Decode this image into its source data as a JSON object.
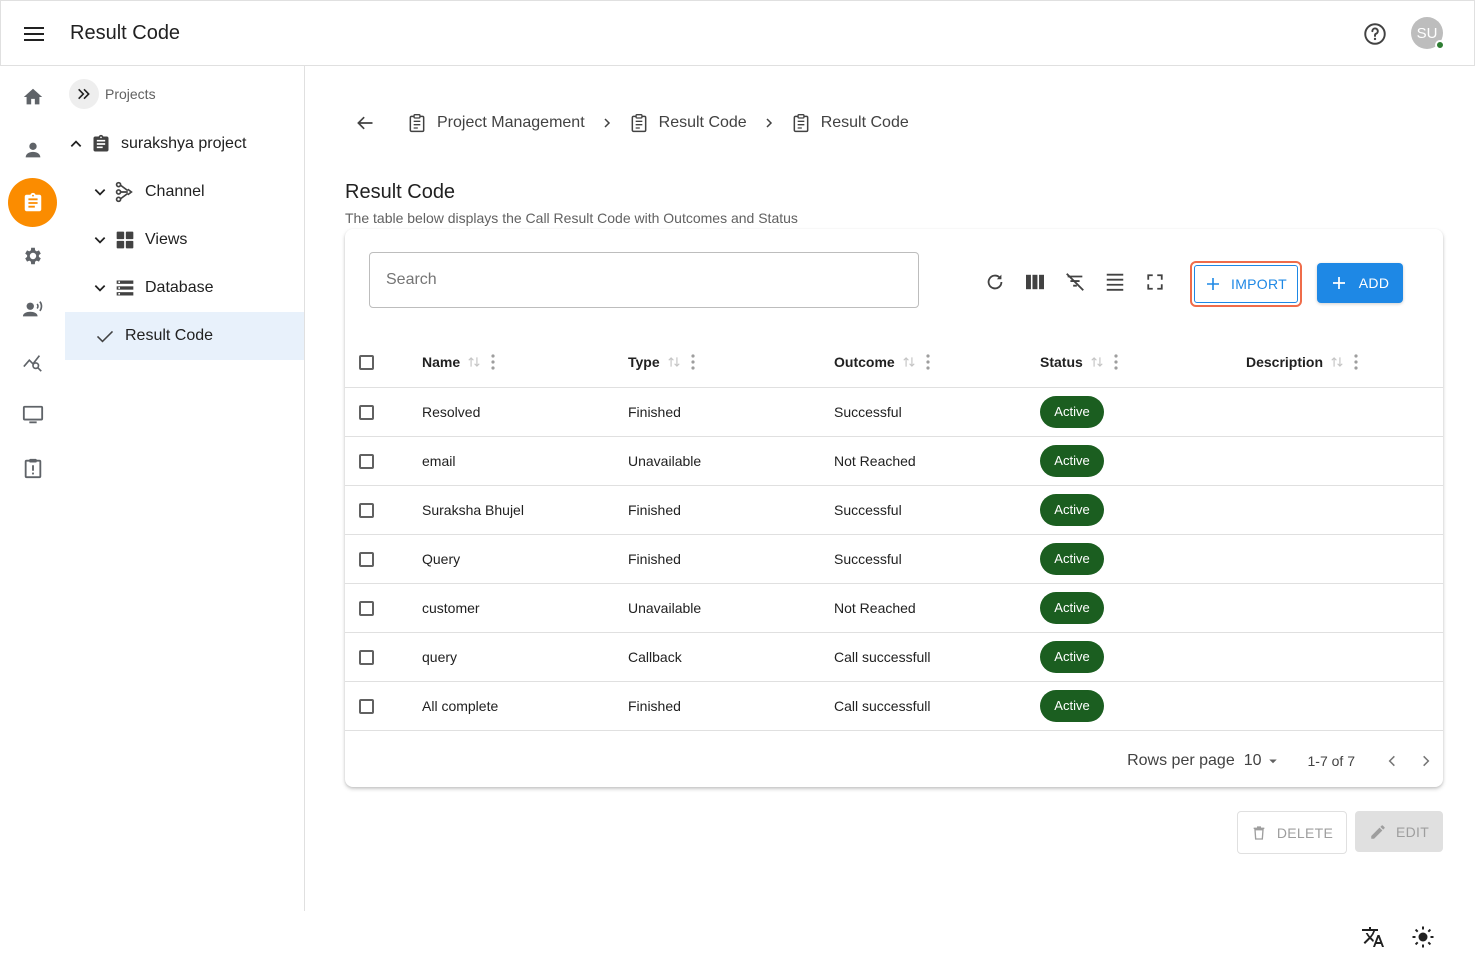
{
  "app": {
    "title": "Result Code",
    "avatar_initials": "SU"
  },
  "rail": {
    "items": [
      {
        "icon": "home-icon"
      },
      {
        "icon": "person-icon"
      },
      {
        "icon": "clipboard-icon",
        "active": true
      },
      {
        "icon": "settings-icon"
      },
      {
        "icon": "voice-agent-icon"
      },
      {
        "icon": "analytics-icon"
      },
      {
        "icon": "monitor-icon"
      },
      {
        "icon": "report-icon"
      }
    ],
    "active_color": "#fb8c00"
  },
  "tree": {
    "header": "Projects",
    "project": "surakshya project",
    "children": [
      {
        "label": "Channel",
        "icon": "channel-icon"
      },
      {
        "label": "Views",
        "icon": "views-icon"
      },
      {
        "label": "Database",
        "icon": "database-icon"
      }
    ],
    "selected": "Result Code"
  },
  "breadcrumb": [
    "Project Management",
    "Result Code",
    "Result Code"
  ],
  "page": {
    "title": "Result Code",
    "subtitle": "The table below displays the Call Result Code with Outcomes and Status"
  },
  "toolbar": {
    "search_placeholder": "Search",
    "import_label": "IMPORT",
    "add_label": "ADD"
  },
  "table": {
    "columns": [
      "Name",
      "Type",
      "Outcome",
      "Status",
      "Description"
    ],
    "rows": [
      {
        "name": "Resolved",
        "type": "Finished",
        "outcome": "Successful",
        "status": "Active",
        "description": ""
      },
      {
        "name": "email",
        "type": "Unavailable",
        "outcome": "Not Reached",
        "status": "Active",
        "description": ""
      },
      {
        "name": "Suraksha Bhujel",
        "type": "Finished",
        "outcome": "Successful",
        "status": "Active",
        "description": ""
      },
      {
        "name": "Query",
        "type": "Finished",
        "outcome": "Successful",
        "status": "Active",
        "description": ""
      },
      {
        "name": "customer",
        "type": "Unavailable",
        "outcome": "Not Reached",
        "status": "Active",
        "description": ""
      },
      {
        "name": "query",
        "type": "Callback",
        "outcome": "Call successfull",
        "status": "Active",
        "description": ""
      },
      {
        "name": "All complete",
        "type": "Finished",
        "outcome": "Call successfull",
        "status": "Active",
        "description": ""
      }
    ],
    "status_color": "#1b5e20"
  },
  "pagination": {
    "rows_per_page_label": "Rows per page",
    "rows_per_page": "10",
    "range": "1-7 of 7"
  },
  "actions": {
    "delete_label": "DELETE",
    "edit_label": "EDIT"
  },
  "colors": {
    "primary": "#1e88e5",
    "import_outline": "#ef6c4a",
    "selected_bg": "#e8f1fb"
  }
}
